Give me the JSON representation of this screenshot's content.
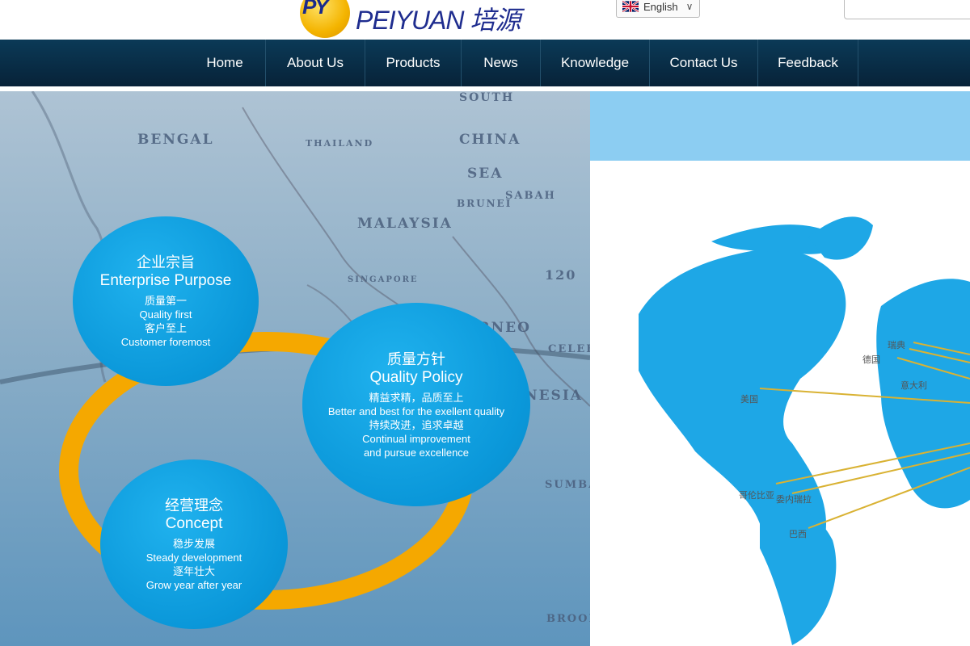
{
  "header": {
    "logo_text": "PEIYUAN 培源",
    "logo_mark": "PY",
    "language": "English",
    "language_flag": "uk-flag-icon"
  },
  "nav": {
    "items": [
      {
        "label": "Home"
      },
      {
        "label": "About Us"
      },
      {
        "label": "Products"
      },
      {
        "label": "News"
      },
      {
        "label": "Knowledge"
      },
      {
        "label": "Contact Us"
      },
      {
        "label": "Feedback"
      }
    ]
  },
  "hero": {
    "purpose": {
      "cn": "企业宗旨",
      "en": "Enterprise Purpose",
      "lines": [
        "质量第一",
        "Quality first",
        "客户至上",
        "Customer foremost"
      ]
    },
    "policy": {
      "cn": "质量方针",
      "en": "Quality Policy",
      "lines": [
        "精益求精，品质至上",
        "Better and best for the exellent quality",
        "持续改进，追求卓越",
        "Continual improvement",
        "and pursue excellence"
      ]
    },
    "concept": {
      "cn": "经营理念",
      "en": "Concept",
      "lines": [
        "稳步发展",
        "Steady development",
        "逐年壮大",
        "Grow year after year"
      ]
    },
    "map_words": [
      "BENGAL",
      "CHINA",
      "SEA",
      "MALAYSIA",
      "BORNEO",
      "INDONESIA",
      "SOUTH",
      "SABAH",
      "BRUNEI",
      "SINGAPORE",
      "THAILAND",
      "120",
      "SUMBA",
      "BROOME",
      "CELEBES"
    ],
    "world_labels": [
      "德国",
      "瑞典",
      "美国",
      "哥伦比亚",
      "委内瑞拉",
      "巴西",
      "意大利"
    ]
  },
  "colors": {
    "nav_bg": "#072238",
    "circle": "#0a97d9",
    "ring": "#f5a800",
    "band": "#8ccdf2",
    "continent": "#1ea7e6"
  }
}
